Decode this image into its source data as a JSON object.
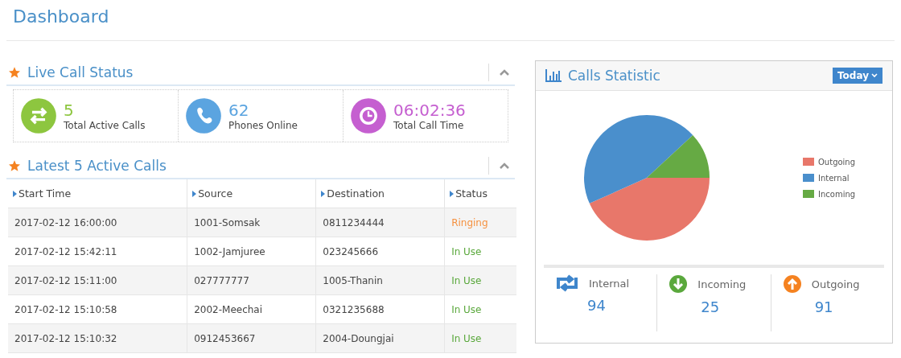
{
  "page_title": "Dashboard",
  "live_status": {
    "title": "Live Call Status",
    "stats": [
      {
        "kind": "active",
        "value": "5",
        "label": "Total Active Calls",
        "color": "#8dc63f"
      },
      {
        "kind": "phones",
        "value": "62",
        "label": "Phones Online",
        "color": "#5ba4e0"
      },
      {
        "kind": "time",
        "value": "06:02:36",
        "label": "Total Call Time",
        "color": "#c55fd0"
      }
    ]
  },
  "active_calls": {
    "title": "Latest 5 Active Calls",
    "columns": [
      "Start Time",
      "Source",
      "Destination",
      "Status"
    ],
    "rows": [
      {
        "cells": [
          "2017-02-12 16:00:00",
          "1001-Somsak",
          "0811234444",
          "Ringing"
        ],
        "color": "#f5913f"
      },
      {
        "cells": [
          "2017-02-12 15:42:11",
          "1002-Jamjuree",
          "023245666",
          "In Use"
        ],
        "color": "#5aa83c"
      },
      {
        "cells": [
          "2017-02-12 15:11:00",
          "027777777",
          "1005-Thanin",
          "In Use"
        ],
        "color": "#5aa83c"
      },
      {
        "cells": [
          "2017-02-12 15:10:58",
          "2002-Meechai",
          "0321235688",
          "In Use"
        ],
        "color": "#5aa83c"
      },
      {
        "cells": [
          "2017-02-12 15:10:32",
          "0912453667",
          "2004-Doungjai",
          "In Use"
        ],
        "color": "#5aa83c"
      }
    ]
  },
  "calls_statistic": {
    "title": "Calls Statistic",
    "period_button": "Today",
    "chart_data": {
      "type": "pie",
      "categories": [
        "Outgoing",
        "Internal",
        "Incoming"
      ],
      "values": [
        43.3,
        44.8,
        11.9
      ],
      "colors": [
        "#e8776a",
        "#4a8fcc",
        "#66aa44"
      ]
    },
    "totals": [
      {
        "kind": "internal",
        "label": "Internal",
        "value": "94"
      },
      {
        "kind": "incoming",
        "label": "Incoming",
        "value": "25"
      },
      {
        "kind": "outgoing",
        "label": "Outgoing",
        "value": "91"
      }
    ]
  }
}
